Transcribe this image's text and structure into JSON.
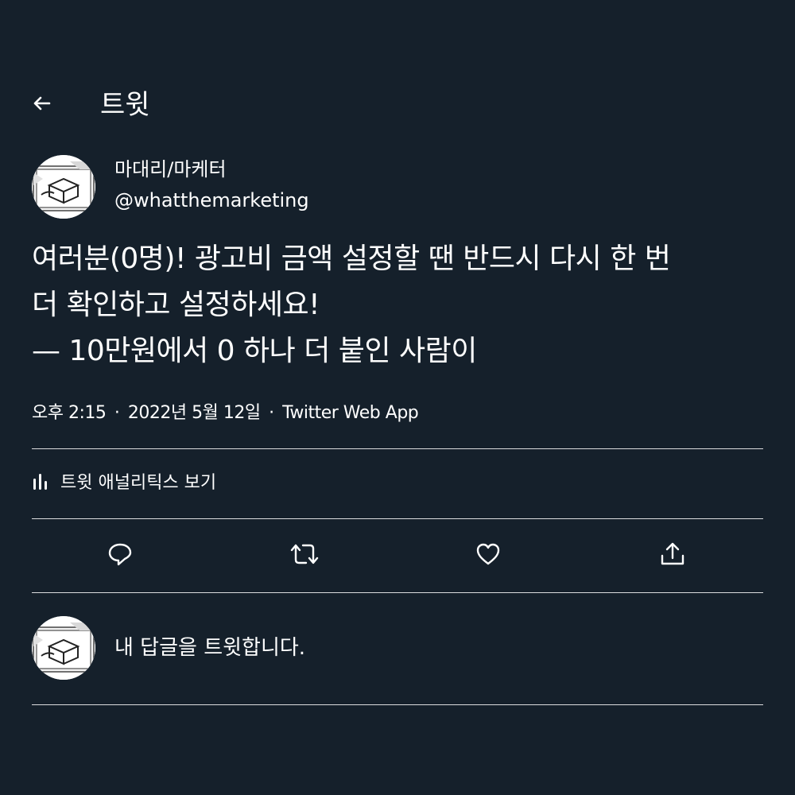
{
  "header": {
    "title": "트윗"
  },
  "author": {
    "name": "마대리/마케터",
    "handle": "@whatthemarketing"
  },
  "tweet": {
    "text": "여러분(0명)! 광고비 금액 설정할 땐 반드시 다시 한 번\n더 확인하고 설정하세요!\n— 10만원에서 0 하나 더 붙인 사람이",
    "time": "오후 2:15",
    "date": "2022년 5월 12일",
    "source": "Twitter Web App",
    "separator": "·"
  },
  "analytics": {
    "label": "트윗 애널리틱스 보기"
  },
  "actions": {
    "reply_icon": "reply-icon",
    "retweet_icon": "retweet-icon",
    "like_icon": "heart-icon",
    "share_icon": "share-icon"
  },
  "reply": {
    "placeholder": "내 답글을 트윗합니다."
  },
  "colors": {
    "background": "#15202b",
    "text": "#ffffff"
  }
}
